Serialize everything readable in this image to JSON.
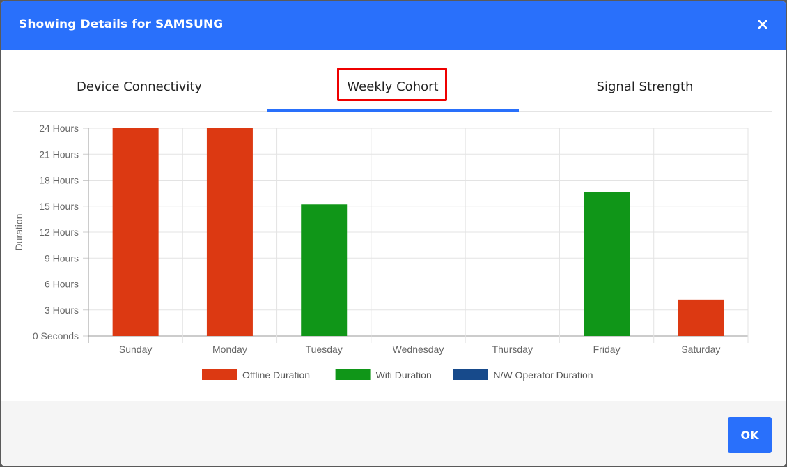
{
  "dialog": {
    "title": "Showing Details for SAMSUNG",
    "close_icon": "close-icon",
    "ok_label": "OK"
  },
  "tabs": [
    {
      "label": "Device Connectivity",
      "active": false
    },
    {
      "label": "Weekly Cohort",
      "active": true
    },
    {
      "label": "Signal Strength",
      "active": false
    }
  ],
  "colors": {
    "header": "#2970fb",
    "offline": "#dc3912",
    "wifi": "#109618",
    "operator": "#174a8b",
    "highlight": "#ee0000"
  },
  "chart_data": {
    "type": "bar",
    "ylabel": "Duration",
    "categories": [
      "Sunday",
      "Monday",
      "Tuesday",
      "Wednesday",
      "Thursday",
      "Friday",
      "Saturday"
    ],
    "y_tick_labels": [
      "0 Seconds",
      "3 Hours",
      "6 Hours",
      "9 Hours",
      "12 Hours",
      "15 Hours",
      "18 Hours",
      "21 Hours",
      "24 Hours"
    ],
    "ylim": [
      0,
      24
    ],
    "grid": true,
    "legend_position": "bottom",
    "series": [
      {
        "name": "Offline Duration",
        "color": "#dc3912",
        "values": [
          24,
          24,
          0,
          0,
          0,
          0,
          4.2
        ]
      },
      {
        "name": "Wifi Duration",
        "color": "#109618",
        "values": [
          0,
          0,
          15.2,
          0,
          0,
          16.6,
          0
        ]
      },
      {
        "name": "N/W Operator Duration",
        "color": "#174a8b",
        "values": [
          0,
          0,
          0,
          0,
          0,
          0,
          0
        ]
      }
    ]
  }
}
